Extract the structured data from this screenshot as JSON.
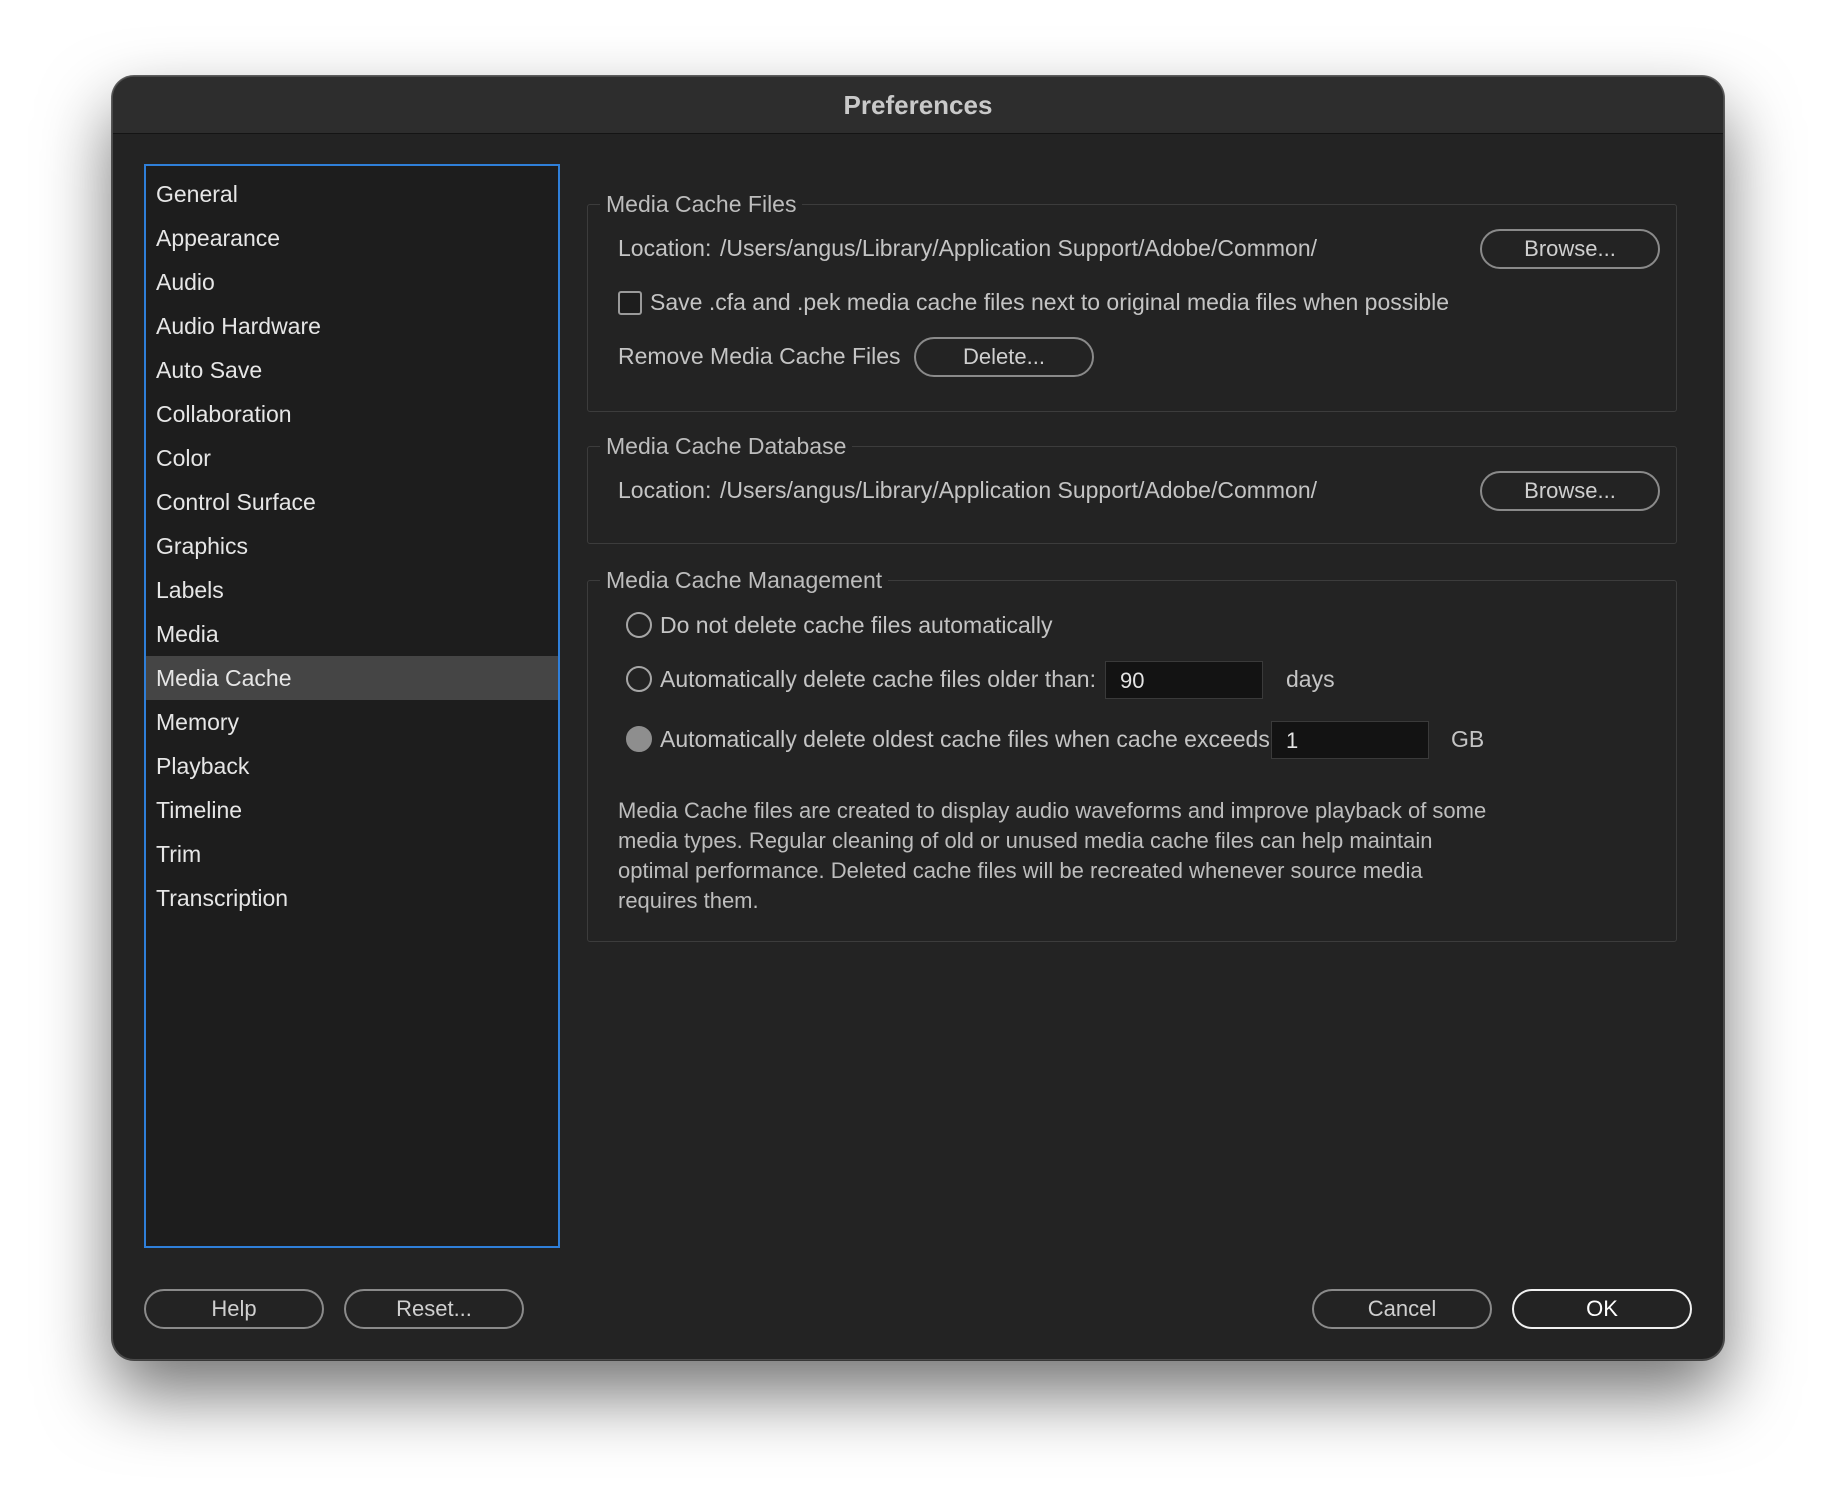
{
  "window": {
    "title": "Preferences"
  },
  "sidebar": {
    "items": [
      {
        "label": "General"
      },
      {
        "label": "Appearance"
      },
      {
        "label": "Audio"
      },
      {
        "label": "Audio Hardware"
      },
      {
        "label": "Auto Save"
      },
      {
        "label": "Collaboration"
      },
      {
        "label": "Color"
      },
      {
        "label": "Control Surface"
      },
      {
        "label": "Graphics"
      },
      {
        "label": "Labels"
      },
      {
        "label": "Media"
      },
      {
        "label": "Media Cache",
        "selected": true
      },
      {
        "label": "Memory"
      },
      {
        "label": "Playback"
      },
      {
        "label": "Timeline"
      },
      {
        "label": "Trim"
      },
      {
        "label": "Transcription"
      }
    ]
  },
  "media_cache_files": {
    "title": "Media Cache Files",
    "location_label": "Location:",
    "location_path": "/Users/angus/Library/Application Support/Adobe/Common/",
    "browse_label": "Browse...",
    "save_next_to_media_label": "Save .cfa and .pek media cache files next to original media files when possible",
    "save_next_to_media_checked": false,
    "remove_label": "Remove Media Cache Files",
    "delete_label": "Delete..."
  },
  "media_cache_database": {
    "title": "Media Cache Database",
    "location_label": "Location:",
    "location_path": "/Users/angus/Library/Application Support/Adobe/Common/",
    "browse_label": "Browse..."
  },
  "media_cache_management": {
    "title": "Media Cache Management",
    "option_no_delete": "Do not delete cache files automatically",
    "option_older_than": "Automatically delete cache files older than:",
    "older_than_value": "90",
    "older_than_unit": "days",
    "option_exceeds": "Automatically delete oldest cache files when cache exceeds:",
    "exceeds_value": "1",
    "exceeds_unit": "GB",
    "selected_option": "exceeds",
    "description": "Media Cache files are created to display audio waveforms and improve playback of some media types.  Regular cleaning of old or unused media cache files can help maintain optimal performance. Deleted cache files will be recreated whenever source media requires them."
  },
  "footer": {
    "help_label": "Help",
    "reset_label": "Reset...",
    "cancel_label": "Cancel",
    "ok_label": "OK"
  },
  "colors": {
    "window_bg": "#232323",
    "list_border_accent": "#2f7fd9",
    "selected_item_bg": "#454545"
  }
}
